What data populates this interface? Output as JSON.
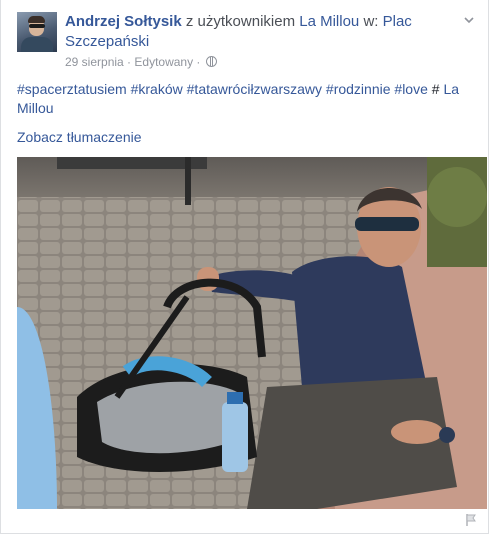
{
  "post": {
    "author": "Andrzej Sołtysik",
    "with_text": " z użytkownikiem ",
    "tagged": "La Millou",
    "at_text": " w: ",
    "place": "Plac Szczepański",
    "date": "29 sierpnia",
    "separator": " · ",
    "edited": "Edytowany",
    "separator2": " · ",
    "hashtags": [
      "#spacerztatusiem",
      "#kraków",
      "#tatawróciłzwarszawy",
      "#rodzinnie",
      "#love"
    ],
    "hash_symbol": "#",
    "mention": "La Millou",
    "translate": "Zobacz tłumaczenie"
  },
  "icons": {
    "menu": "chevron-down-icon",
    "privacy": "globe-icon",
    "report": "flag-icon"
  },
  "colors": {
    "link": "#365899",
    "meta": "#90949c",
    "text": "#1d2129"
  }
}
